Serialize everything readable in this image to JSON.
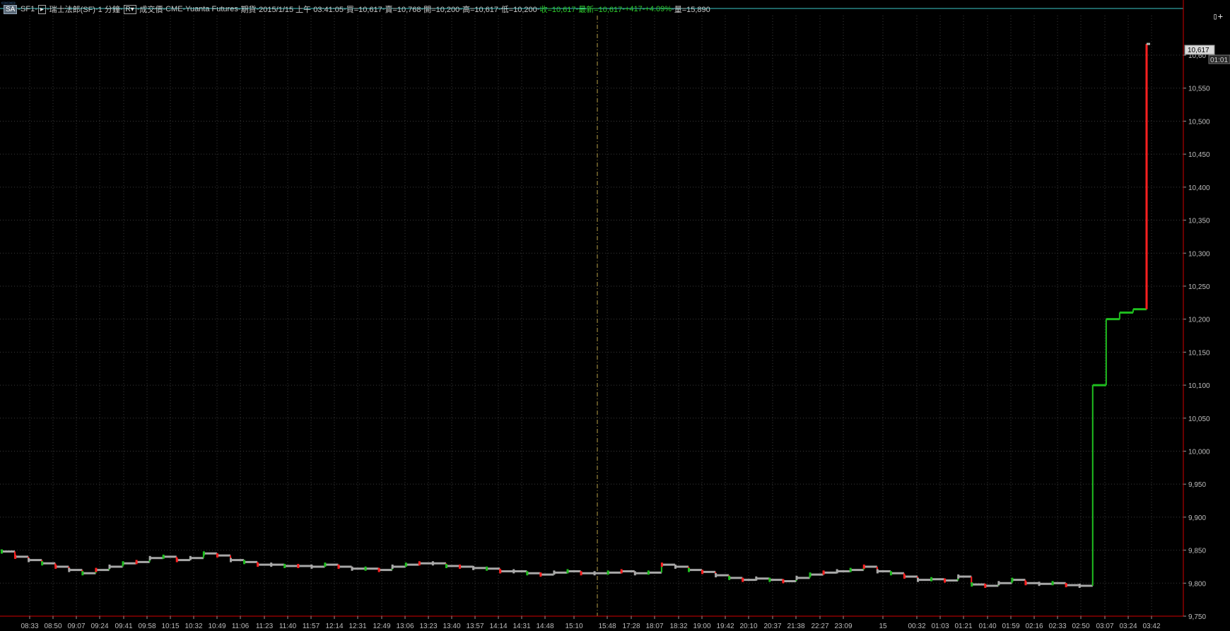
{
  "header": {
    "sa_label": "SA",
    "symbol": "SF1",
    "box1": "▸",
    "product": "瑞士法郎(SF)",
    "interval": "1 分鐘",
    "box2": "R▾",
    "price_type": "成交價",
    "exchange": "CME",
    "broker": "Yuanta Futures",
    "market": "期貨",
    "datetime": "2015/1/15 上午 03:41:05",
    "bid": "買=10,617",
    "ask": "賣=10,768",
    "open": "開=10,200",
    "high": "高=10,617",
    "low": "低=10,200",
    "close": "收=10,617",
    "last": "最新=10,617",
    "change": "+417",
    "change_pct": "+4.09%",
    "volume": "量=15,890"
  },
  "corner_icon": "panel-toggle-icon",
  "price_badge": {
    "value": "10,617",
    "countdown": "01:01"
  },
  "colors": {
    "background": "#000000",
    "grid": "#3a3a3a",
    "up": "#1fbf1f",
    "down": "#ff2020",
    "flat": "#a0a0a0",
    "session_divider": "#b8a24a",
    "top_line": "#3cc8c8",
    "axis_line": "#d00000"
  },
  "chart_data": {
    "type": "line",
    "title": "",
    "xlabel": "",
    "ylabel": "",
    "ylim": [
      9750,
      10660
    ],
    "y_ticks": [
      9750,
      9800,
      9850,
      9900,
      9950,
      10000,
      10050,
      10100,
      10150,
      10200,
      10250,
      10300,
      10350,
      10400,
      10450,
      10500,
      10550,
      10600
    ],
    "y_tick_labels": [
      "9,750",
      "9,800",
      "9,850",
      "9,900",
      "9,950",
      "10,000",
      "10,050",
      "10,100",
      "10,150",
      "10,200",
      "10,250",
      "10,300",
      "10,350",
      "10,400",
      "10,450",
      "10,500",
      "10,550",
      "10,60"
    ],
    "x_tick_labels": [
      "08:33",
      "08:50",
      "09:07",
      "09:24",
      "09:41",
      "09:58",
      "10:15",
      "10:32",
      "10:49",
      "11:06",
      "11:23",
      "11:40",
      "11:57",
      "12:14",
      "12:31",
      "12:49",
      "13:06",
      "13:23",
      "13:40",
      "13:57",
      "14:14",
      "14:31",
      "14:48",
      "15:10",
      "15:48",
      "17:28",
      "18:07",
      "18:32",
      "19:00",
      "19:42",
      "20:10",
      "20:37",
      "21:38",
      "22:27",
      "23:09",
      "15",
      "00:32",
      "01:03",
      "01:21",
      "01:40",
      "01:59",
      "02:16",
      "02:33",
      "02:50",
      "03:07",
      "03:24",
      "03:42"
    ],
    "session_break_after_label": "15:10",
    "grid": true,
    "series": [
      {
        "values": [
          9848,
          9840,
          9835,
          9830,
          9825,
          9820,
          9815,
          9820,
          9825,
          9830,
          9832,
          9838,
          9840,
          9835,
          9838,
          9845,
          9842,
          9835,
          9832,
          9828,
          9828,
          9826,
          9826,
          9825,
          9828,
          9825,
          9822,
          9822,
          9820,
          9825,
          9828,
          9830,
          9830,
          9826,
          9825,
          9823,
          9822,
          9818,
          9818,
          9815,
          9813,
          9816,
          9818,
          9815,
          9815,
          9816,
          9818,
          9815,
          9816,
          9828,
          9825,
          9820,
          9817,
          9812,
          9808,
          9805,
          9807,
          9805,
          9803,
          9808,
          9813,
          9816,
          9818,
          9820,
          9825,
          9818,
          9815,
          9810,
          9805,
          9806,
          9804,
          9810,
          9798,
          9796,
          9800,
          9805,
          9800,
          9799,
          9800,
          9797,
          9796,
          10100,
          10200,
          10210,
          10215,
          10617
        ]
      }
    ]
  }
}
